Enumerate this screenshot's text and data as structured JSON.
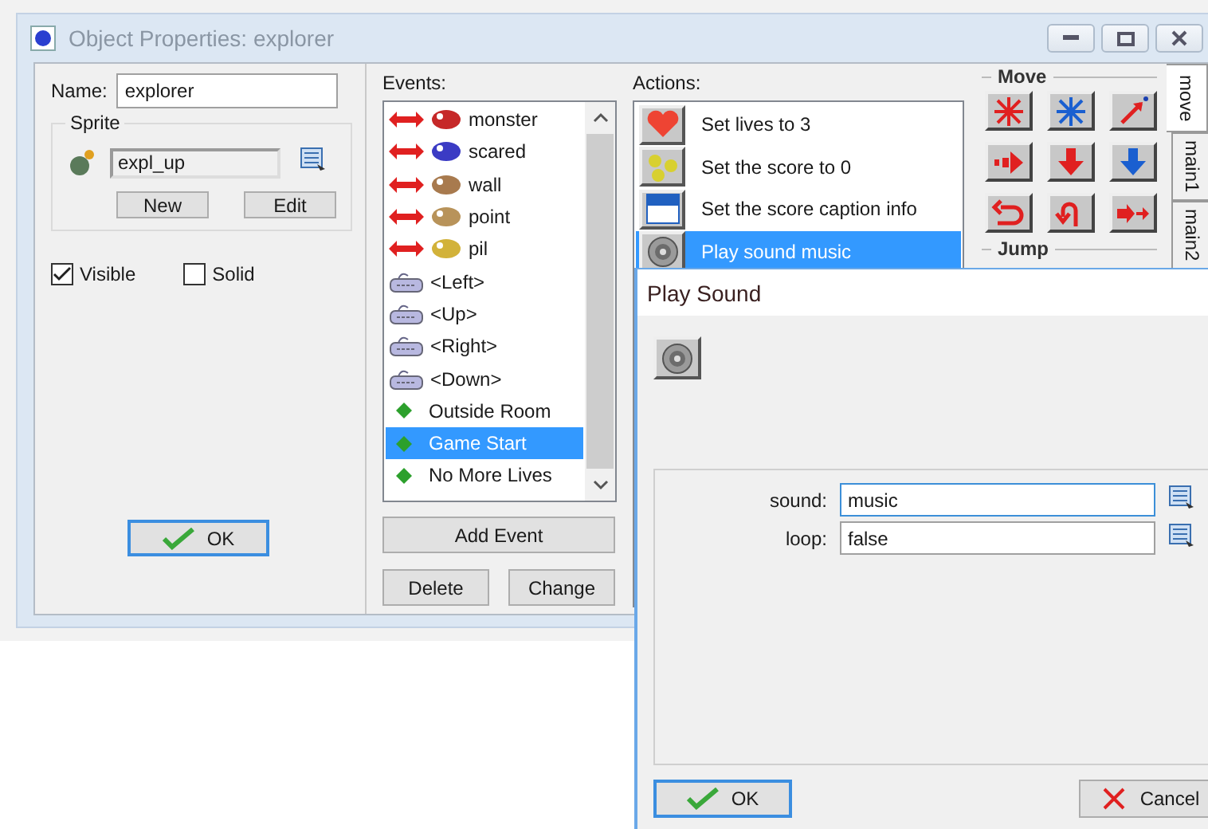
{
  "main_window": {
    "title": "Object Properties: explorer",
    "name_label": "Name:",
    "name_value": "explorer",
    "sprite": {
      "legend": "Sprite",
      "value": "expl_up",
      "buttons": [
        "New",
        "Edit"
      ]
    },
    "checkboxes": [
      {
        "label": "Visible",
        "checked": true
      },
      {
        "label": "Solid",
        "checked": false
      }
    ],
    "ok_button": "OK",
    "events": {
      "label": "Events:",
      "items": [
        {
          "kind": "collision",
          "label": "monster",
          "color": "#c62828",
          "selected": false
        },
        {
          "kind": "collision",
          "label": "scared",
          "color": "#3b3bc4",
          "selected": false
        },
        {
          "kind": "collision",
          "label": "wall",
          "color": "#a87a4e",
          "selected": false
        },
        {
          "kind": "collision",
          "label": "point",
          "color": "#b8935a",
          "selected": false
        },
        {
          "kind": "collision",
          "label": "pil",
          "color": "#d2b23a",
          "selected": false
        },
        {
          "kind": "keyboard",
          "label": "<Left>",
          "selected": false
        },
        {
          "kind": "keyboard",
          "label": "<Up>",
          "selected": false
        },
        {
          "kind": "keyboard",
          "label": "<Right>",
          "selected": false
        },
        {
          "kind": "keyboard",
          "label": "<Down>",
          "selected": false
        },
        {
          "kind": "other",
          "label": "Outside Room",
          "selected": false
        },
        {
          "kind": "other",
          "label": "Game Start",
          "selected": true
        },
        {
          "kind": "other",
          "label": "No More Lives",
          "selected": false
        }
      ]
    },
    "event_buttons": [
      "Add Event",
      "Delete",
      "Change"
    ],
    "actions": {
      "label": "Actions:",
      "items": [
        {
          "kind": "lives",
          "label": "Set lives to 3",
          "selected": false
        },
        {
          "kind": "score",
          "label": "Set the score to 0",
          "selected": false
        },
        {
          "kind": "caption",
          "label": "Set the score caption info",
          "selected": false
        },
        {
          "kind": "sound",
          "label": "Play sound music",
          "selected": true
        }
      ]
    },
    "library": {
      "group_label": "Move",
      "next_group_label": "Jump",
      "tabs": [
        {
          "label": "move",
          "selected": true
        },
        {
          "label": "main1",
          "selected": false
        },
        {
          "label": "main2",
          "selected": false
        }
      ]
    }
  },
  "dialog": {
    "title": "Play Sound",
    "fields": [
      {
        "label": "sound:",
        "value": "music"
      },
      {
        "label": "loop:",
        "value": "false"
      }
    ],
    "ok_button": "OK",
    "cancel_button": "Cancel"
  }
}
